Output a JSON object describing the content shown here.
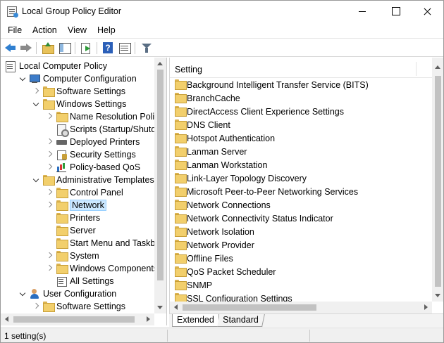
{
  "window": {
    "title": "Local Group Policy Editor"
  },
  "menu": [
    "File",
    "Action",
    "View",
    "Help"
  ],
  "tree": [
    {
      "label": "Local Computer Policy",
      "level": 0,
      "icon": "doc-icon",
      "expander": "none"
    },
    {
      "label": "Computer Configuration",
      "level": 1,
      "icon": "computer-icon",
      "expander": "open"
    },
    {
      "label": "Software Settings",
      "level": 2,
      "icon": "folder-icon",
      "expander": "closed"
    },
    {
      "label": "Windows Settings",
      "level": 2,
      "icon": "folder-icon",
      "expander": "open"
    },
    {
      "label": "Name Resolution Policy",
      "level": 3,
      "icon": "folder-icon",
      "expander": "closed"
    },
    {
      "label": "Scripts (Startup/Shutdow",
      "level": 3,
      "icon": "script-icon",
      "expander": "none"
    },
    {
      "label": "Deployed Printers",
      "level": 3,
      "icon": "printer-icon",
      "expander": "closed"
    },
    {
      "label": "Security Settings",
      "level": 3,
      "icon": "security-icon",
      "expander": "closed"
    },
    {
      "label": "Policy-based QoS",
      "level": 3,
      "icon": "qos-icon",
      "expander": "closed"
    },
    {
      "label": "Administrative Templates",
      "level": 2,
      "icon": "folder-icon",
      "expander": "open"
    },
    {
      "label": "Control Panel",
      "level": 3,
      "icon": "folder-icon",
      "expander": "closed"
    },
    {
      "label": "Network",
      "level": 3,
      "icon": "folder-icon",
      "expander": "closed",
      "selected": true
    },
    {
      "label": "Printers",
      "level": 3,
      "icon": "folder-icon",
      "expander": "none"
    },
    {
      "label": "Server",
      "level": 3,
      "icon": "folder-icon",
      "expander": "none"
    },
    {
      "label": "Start Menu and Taskbar",
      "level": 3,
      "icon": "folder-icon",
      "expander": "none"
    },
    {
      "label": "System",
      "level": 3,
      "icon": "folder-icon",
      "expander": "closed"
    },
    {
      "label": "Windows Components",
      "level": 3,
      "icon": "folder-icon",
      "expander": "closed"
    },
    {
      "label": "All Settings",
      "level": 3,
      "icon": "all-settings-icon",
      "expander": "none"
    },
    {
      "label": "User Configuration",
      "level": 1,
      "icon": "user-icon",
      "expander": "open"
    },
    {
      "label": "Software Settings",
      "level": 2,
      "icon": "folder-icon",
      "expander": "closed"
    }
  ],
  "list": {
    "header": "Setting",
    "items": [
      "Background Intelligent Transfer Service (BITS)",
      "BranchCache",
      "DirectAccess Client Experience Settings",
      "DNS Client",
      "Hotspot Authentication",
      "Lanman Server",
      "Lanman Workstation",
      "Link-Layer Topology Discovery",
      "Microsoft Peer-to-Peer Networking Services",
      "Network Connections",
      "Network Connectivity Status Indicator",
      "Network Isolation",
      "Network Provider",
      "Offline Files",
      "QoS Packet Scheduler",
      "SNMP",
      "SSL Configuration Settings"
    ]
  },
  "tabs": {
    "extended": "Extended",
    "standard": "Standard"
  },
  "status": {
    "text": "1 setting(s)"
  },
  "colors": {
    "selection_bg": "#cce8ff",
    "selection_border": "#99d1ff",
    "folder": "#f2cf6c"
  }
}
